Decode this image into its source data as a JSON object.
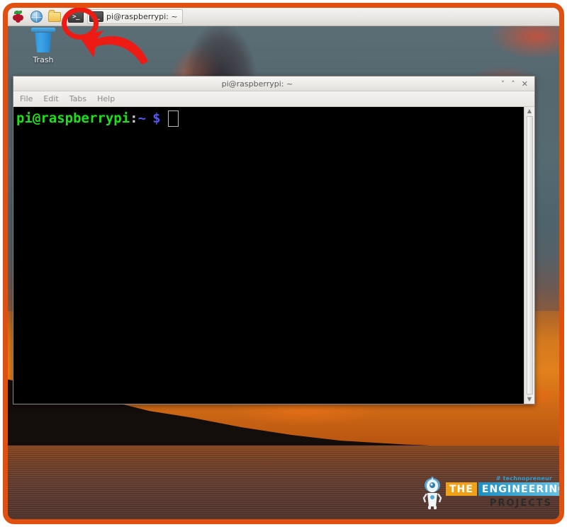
{
  "frame": {
    "border_color": "#e1500f"
  },
  "taskbar": {
    "launchers": [
      {
        "name": "raspberry-menu-icon",
        "label": "Raspberry Pi Menu"
      },
      {
        "name": "web-browser-icon",
        "label": "Web Browser"
      },
      {
        "name": "file-manager-icon",
        "label": "File Manager"
      },
      {
        "name": "terminal-launcher-icon",
        "label": ">_"
      }
    ],
    "window_button": {
      "icon_label": ">_",
      "label": "pi@raspberrypi: ~"
    }
  },
  "desktop": {
    "trash": {
      "label": "Trash"
    }
  },
  "annotations": {
    "circle": {
      "target": "terminal-launcher-icon",
      "color": "#ee1b15"
    },
    "arrow": {
      "direction": "up-left",
      "color": "#ee1b15"
    }
  },
  "terminal": {
    "title": "pi@raspberrypi: ~",
    "controls": {
      "minimize": "˅",
      "maximize": "˄",
      "close": "✕"
    },
    "menu": [
      "File",
      "Edit",
      "Tabs",
      "Help"
    ],
    "prompt": {
      "user_host": "pi@raspberrypi",
      "separator": ":",
      "path": "~",
      "symbol": "$"
    },
    "scrollbar": {
      "up": "▲",
      "down": "▼"
    }
  },
  "watermark": {
    "tag": "# technopreneur",
    "the": "THE",
    "engineering": "ENGINEERING",
    "projects": "PROJECTS"
  }
}
